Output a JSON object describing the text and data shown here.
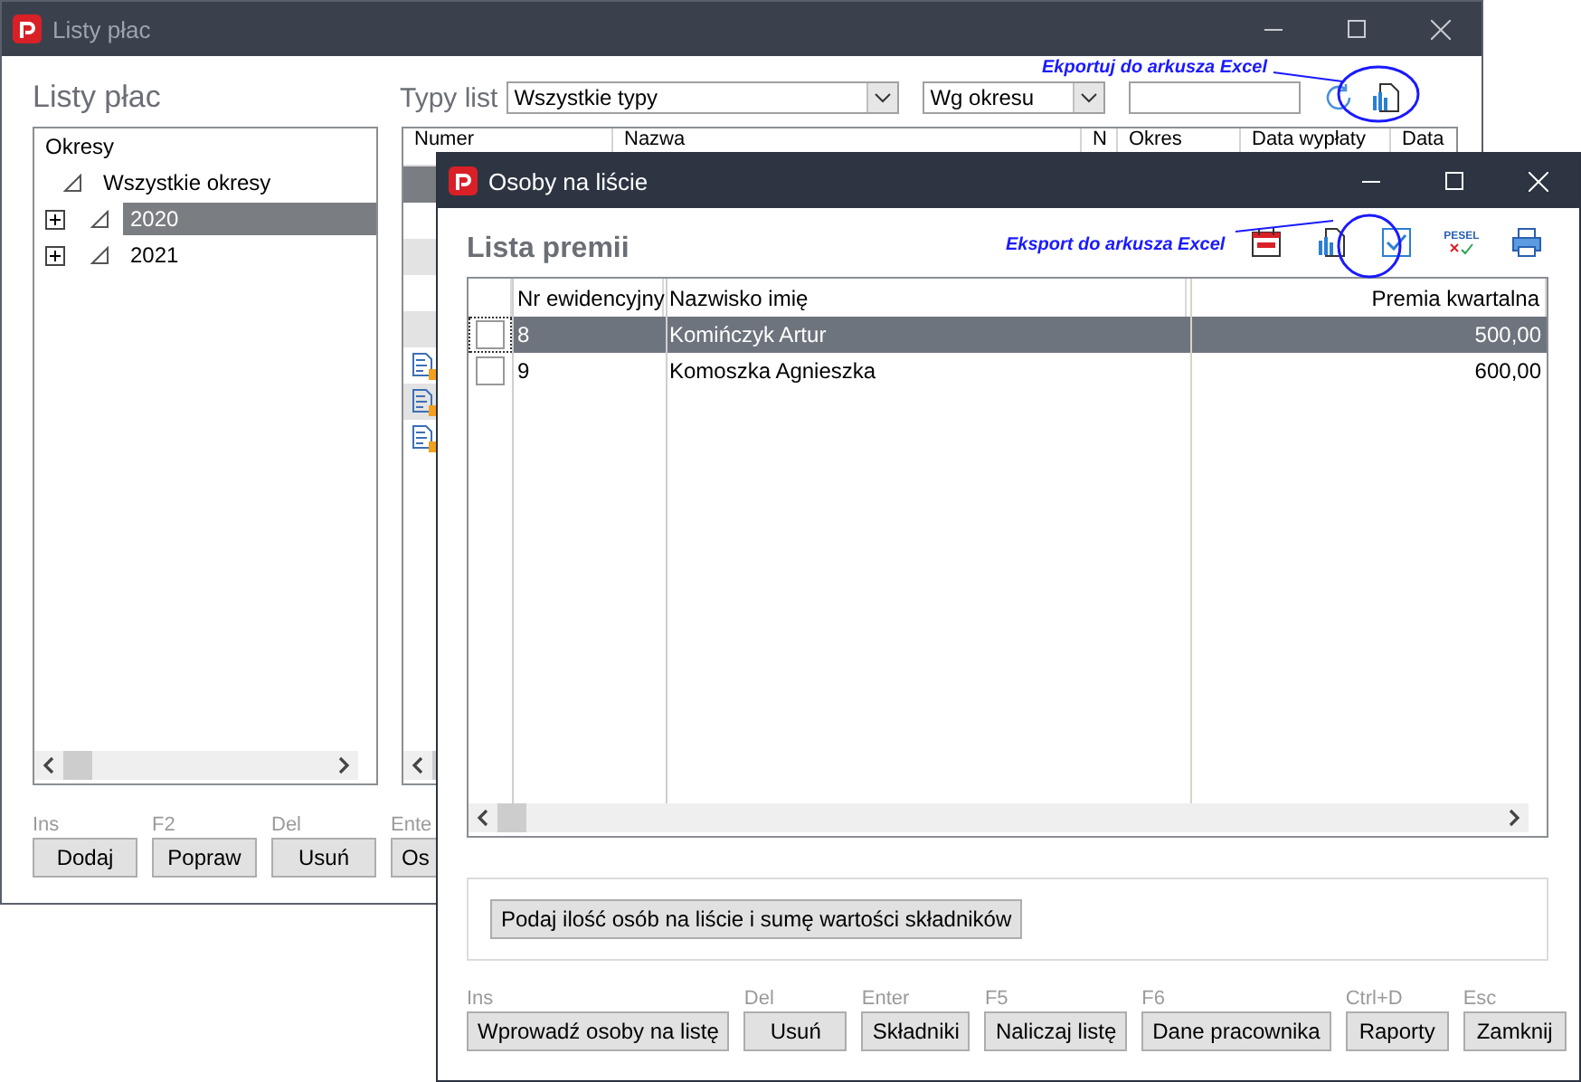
{
  "background_window": {
    "title": "Listy płac",
    "heading": "Listy płac",
    "filter": {
      "label": "Typy list",
      "type_select": {
        "value": "Wszystkie typy"
      },
      "period_select": {
        "value": "Wg okresu"
      }
    },
    "tree": {
      "header": "Okresy",
      "items": [
        {
          "label": "Wszystkie okresy",
          "selected": false,
          "children": [
            {
              "label": "2020",
              "selected": true,
              "expanded": false
            },
            {
              "label": "2021",
              "selected": false,
              "expanded": false
            }
          ]
        }
      ]
    },
    "table": {
      "columns": [
        "Numer",
        "Nazwa",
        "N",
        "Okres",
        "Data wypłaty",
        "Data"
      ],
      "rows": [
        {
          "selected": true,
          "striped": false,
          "locked": false
        },
        {
          "selected": false,
          "striped": true,
          "locked": false
        },
        {
          "selected": false,
          "striped": true,
          "locked": false
        },
        {
          "selected": false,
          "striped": false,
          "locked": true
        },
        {
          "selected": false,
          "striped": true,
          "locked": true
        },
        {
          "selected": false,
          "striped": false,
          "locked": true
        }
      ]
    },
    "buttons": [
      {
        "shortcut": "Ins",
        "label": "Dodaj"
      },
      {
        "shortcut": "F2",
        "label": "Popraw"
      },
      {
        "shortcut": "Del",
        "label": "Usuń"
      },
      {
        "shortcut": "Ente",
        "label": "Os"
      }
    ]
  },
  "annotations": [
    {
      "text": "Ekportuj do arkusza Excel"
    },
    {
      "text": "Eksport do arkusza Excel"
    }
  ],
  "dialog": {
    "title": "Osoby na liście",
    "heading": "Lista premii",
    "toolbar": [
      {
        "kind": "calendar"
      },
      {
        "kind": "export"
      },
      {
        "kind": "check"
      },
      {
        "kind": "pesel",
        "label": "PESEL"
      },
      {
        "kind": "print"
      }
    ],
    "table": {
      "columns": [
        "Nr ewidencyjny",
        "Nazwisko imię",
        "Premia kwartalna"
      ],
      "rows": [
        {
          "checked": false,
          "selected": true,
          "number": "8",
          "name": "Komińczyk Artur",
          "premium": "500,00"
        },
        {
          "checked": false,
          "selected": false,
          "number": "9",
          "name": "Komoszka Agnieszka",
          "premium": "600,00"
        }
      ]
    },
    "summary_button": "Podaj ilość osób na liście i sumę wartości składników",
    "buttons": [
      {
        "shortcut": "Ins",
        "label": "Wprowadź osoby na listę"
      },
      {
        "shortcut": "Del",
        "label": "Usuń"
      },
      {
        "shortcut": "Enter",
        "label": "Składniki"
      },
      {
        "shortcut": "F5",
        "label": "Naliczaj listę"
      },
      {
        "shortcut": "F6",
        "label": "Dane pracownika"
      },
      {
        "shortcut": "Ctrl+D",
        "label": "Raporty"
      },
      {
        "shortcut": "Esc",
        "label": "Zamknij",
        "far": true
      }
    ]
  }
}
